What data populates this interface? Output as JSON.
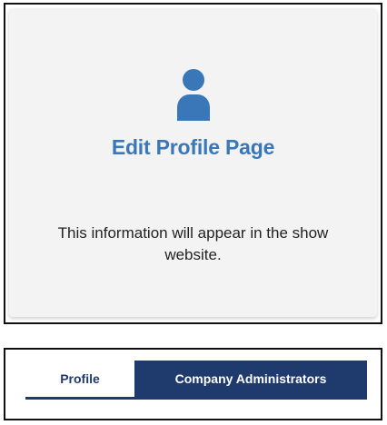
{
  "card": {
    "title": "Edit Profile Page",
    "description": "This information will appear in the show website.",
    "icon": "user-profile-icon",
    "accent_color": "#3a77b8"
  },
  "tabs": {
    "items": [
      {
        "label": "Profile",
        "active": false
      },
      {
        "label": "Company Administrators",
        "active": true
      }
    ],
    "active_color": "#1f3a6d"
  }
}
